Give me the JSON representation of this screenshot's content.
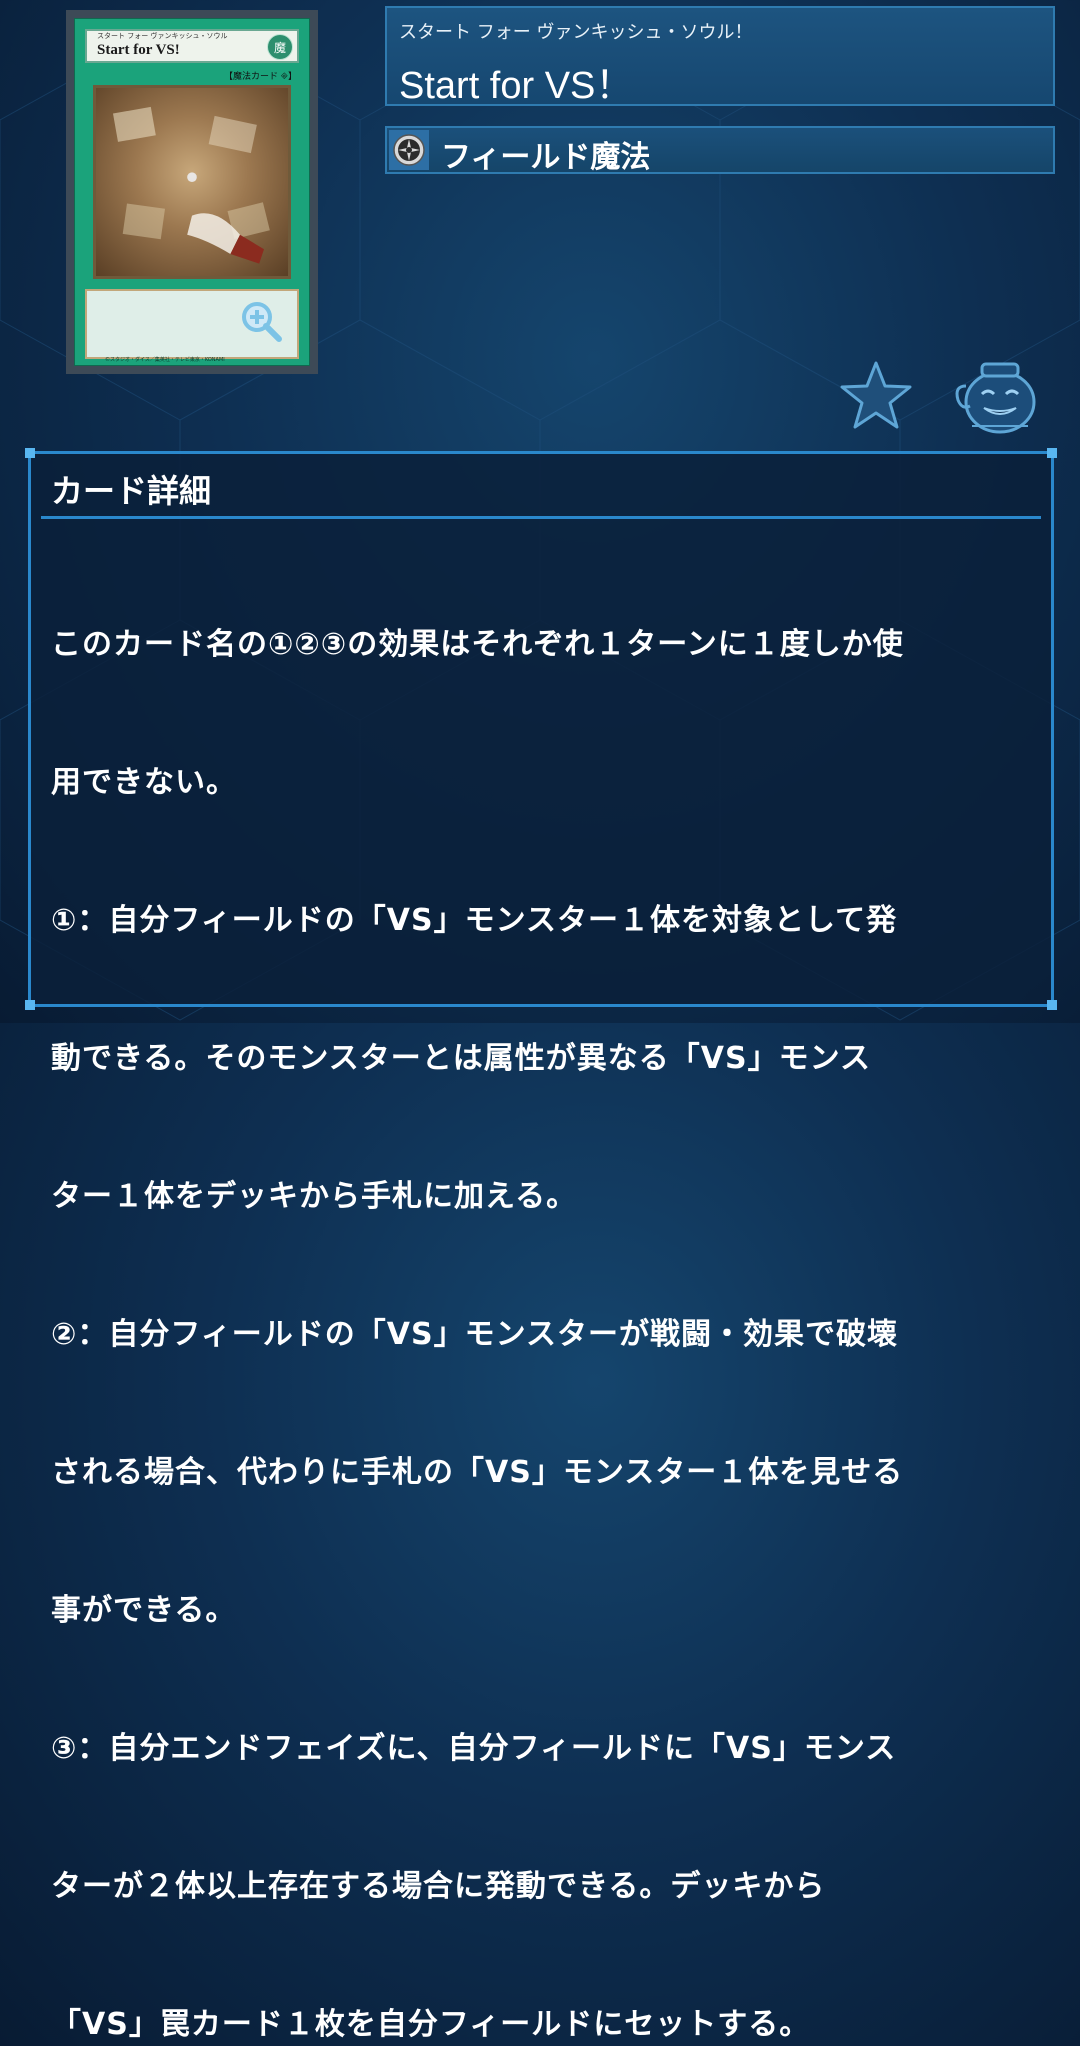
{
  "card": {
    "ruby": "スタート フォー ヴァンキッシュ・ソウル",
    "name": "Start for VS!",
    "attribute_glyph": "魔",
    "type_line": "【魔法カード 🞜】",
    "copyright": "©スタジオ・ダイス／集英社・テレビ東京・KONAMI",
    "zoom_icon": "zoom-in-icon"
  },
  "title": {
    "ruby": "スタート フォー ヴァンキッシュ・ソウル！",
    "name": "Start for VS！"
  },
  "spell_type": {
    "icon": "field-spell-icon",
    "label": "フィールド魔法"
  },
  "actions": {
    "favorite_icon": "star-icon",
    "mascot_icon": "pot-of-greed-icon"
  },
  "detail": {
    "heading": "カード詳細",
    "lines": [
      "このカード名の①②③の効果はそれぞれ１ターンに１度しか使",
      "用できない。",
      "①：自分フィールドの「VS」モンスター１体を対象として発",
      "動できる。そのモンスターとは属性が異なる「VS」モンス",
      "ター１体をデッキから手札に加える。",
      "②：自分フィールドの「VS」モンスターが戦闘・効果で破壊",
      "される場合、代わりに手札の「VS」モンスター１体を見せる",
      "事ができる。",
      "③：自分エンドフェイズに、自分フィールドに「VS」モンス",
      "ターが２体以上存在する場合に発動できる。デッキから",
      "「VS」罠カード１枚を自分フィールドにセットする。"
    ]
  },
  "colors": {
    "panel_border": "#2a88cc",
    "card_frame": "#1ba37b"
  }
}
